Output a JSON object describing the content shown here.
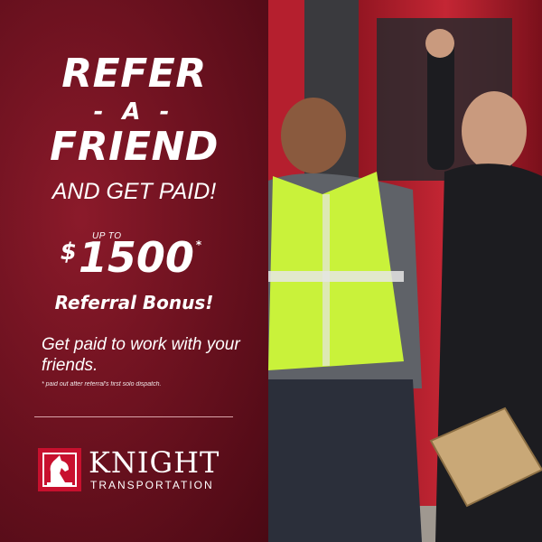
{
  "headline": {
    "refer": "REFER",
    "a": "- A -",
    "friend": "FRIEND",
    "and_get_paid": "AND GET PAID!"
  },
  "offer": {
    "up_to": "UP TO",
    "currency": "$",
    "amount": "1500",
    "asterisk": "*",
    "bonus_label": "Referral Bonus!"
  },
  "subtext": "Get paid to work with your friends.",
  "fine_print": "* paid out after referral's first solo dispatch.",
  "logo": {
    "name": "KNIGHT",
    "tagline": "TRANSPORTATION"
  },
  "colors": {
    "panel": "#6e1220",
    "logo_red": "#c8102e",
    "vest": "#c9f23a",
    "truck": "#b51f2e"
  }
}
